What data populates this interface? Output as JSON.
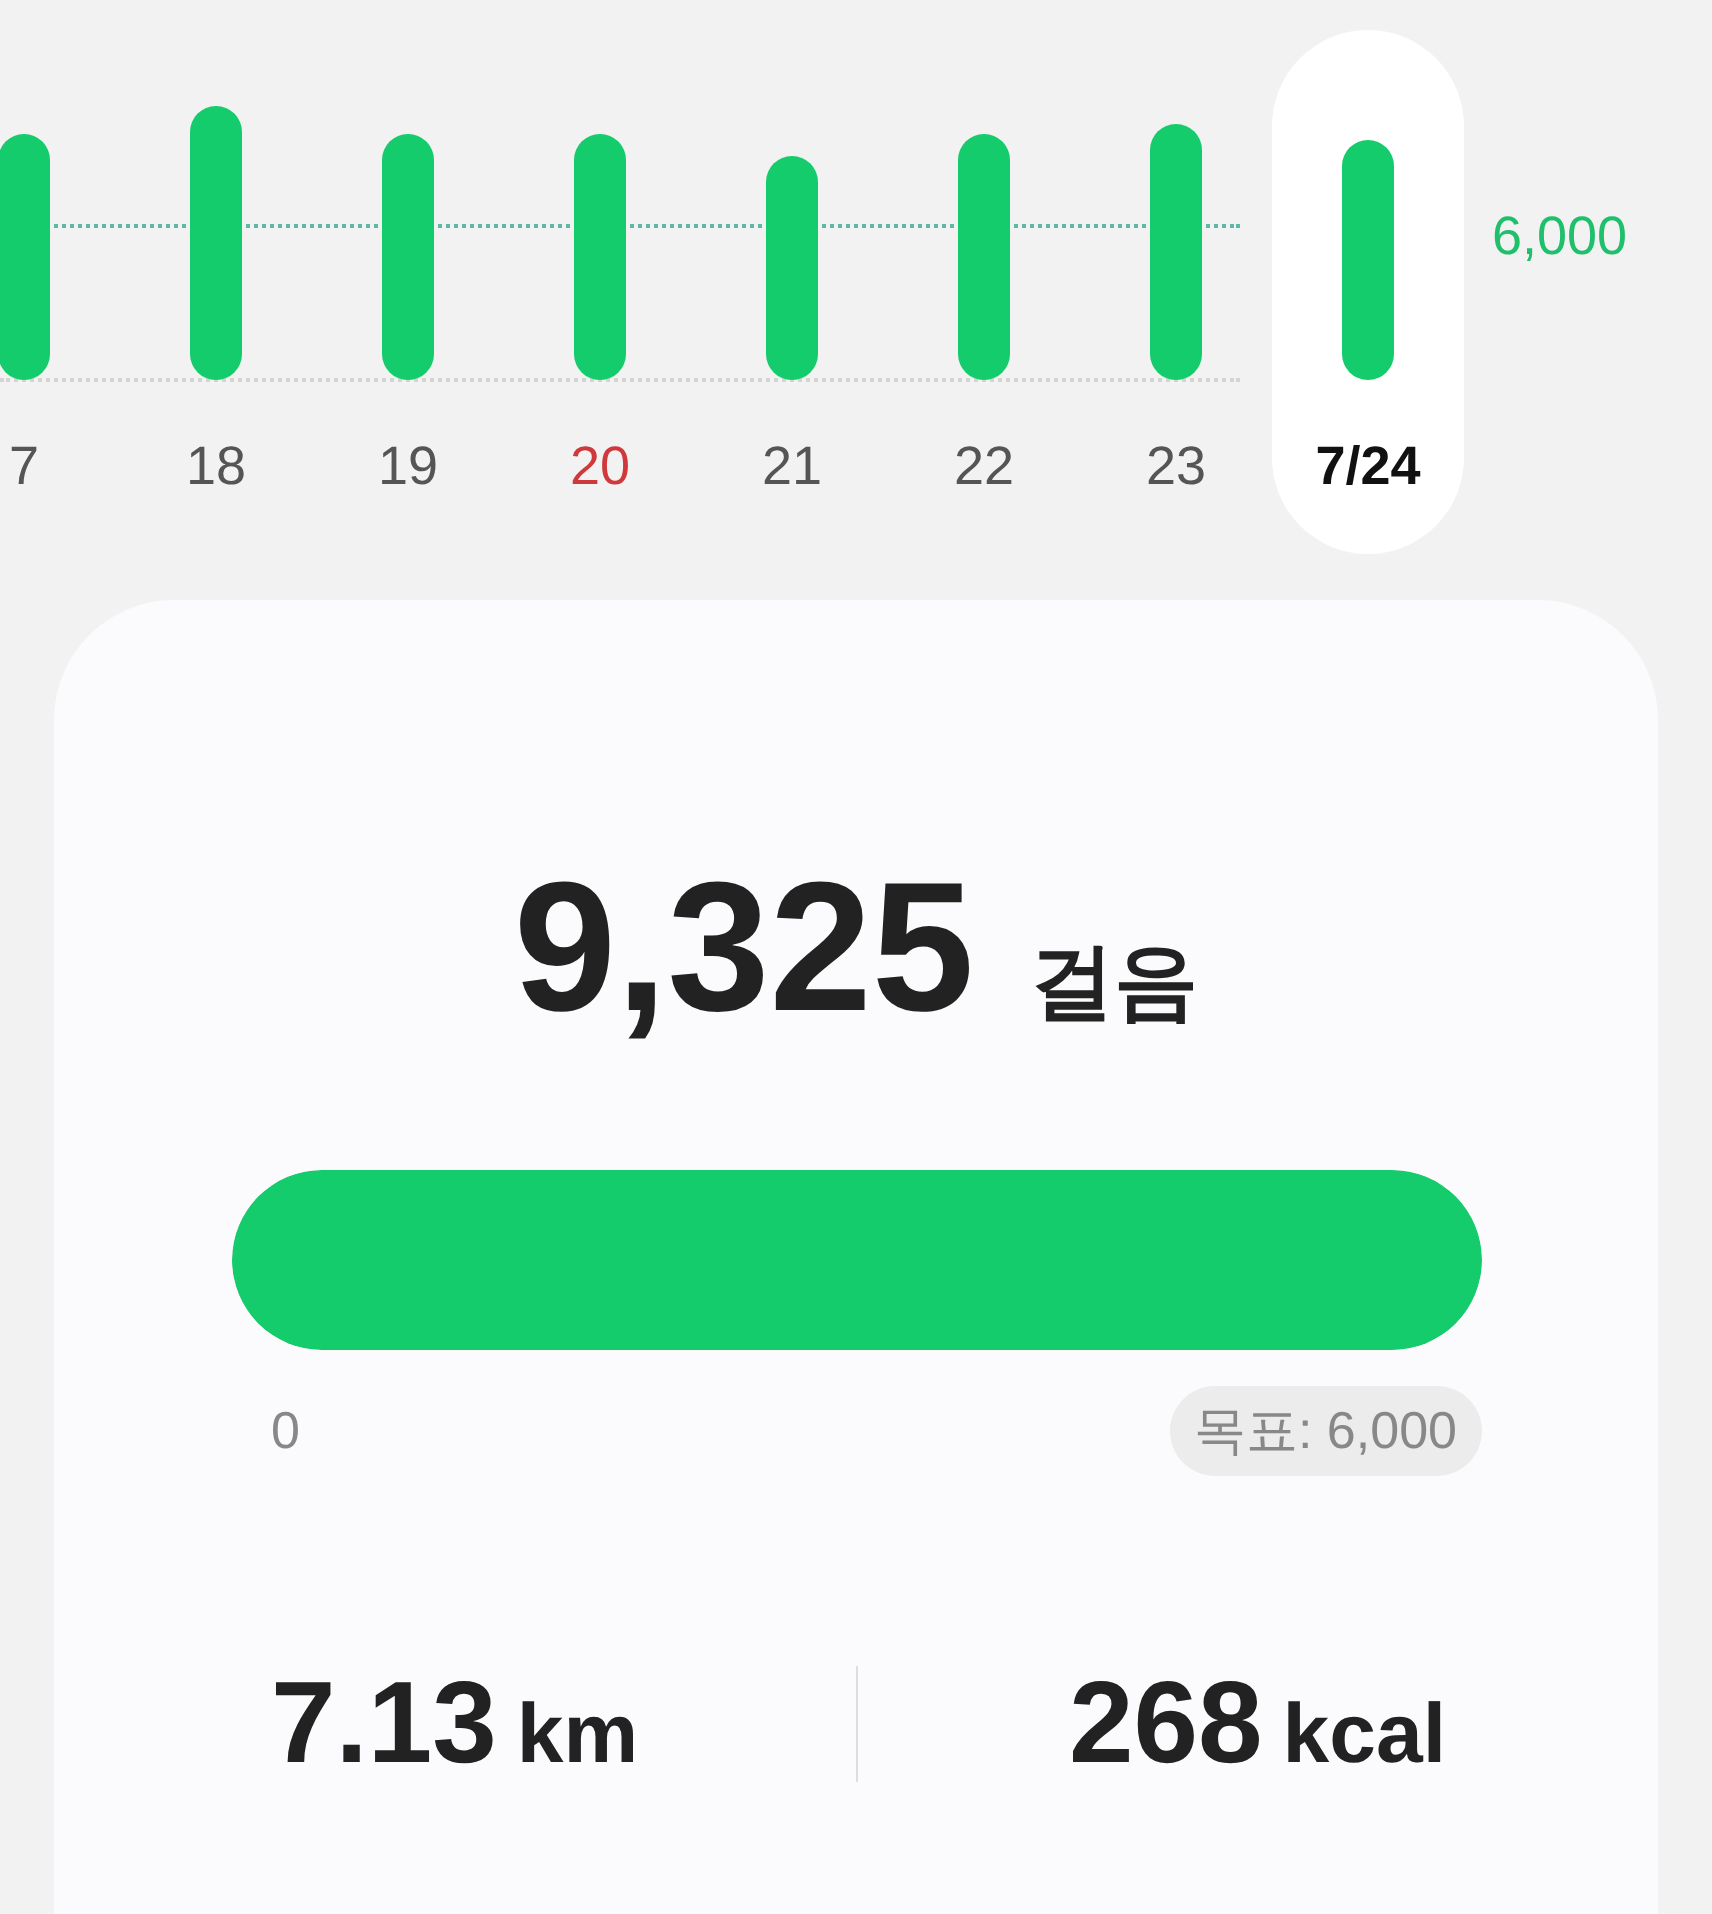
{
  "chart": {
    "goal_label": "6,000",
    "days": [
      {
        "label": "7",
        "selected": false,
        "color": "#555555"
      },
      {
        "label": "18",
        "selected": false,
        "color": "#555555"
      },
      {
        "label": "19",
        "selected": false,
        "color": "#555555"
      },
      {
        "label": "20",
        "selected": false,
        "color": "#d0393b"
      },
      {
        "label": "21",
        "selected": false,
        "color": "#555555"
      },
      {
        "label": "22",
        "selected": false,
        "color": "#555555"
      },
      {
        "label": "23",
        "selected": false,
        "color": "#555555"
      },
      {
        "label": "7/24",
        "selected": true,
        "color": "#111111"
      }
    ]
  },
  "summary": {
    "steps": "9,325",
    "steps_unit": "걸음",
    "progress": {
      "level": 1,
      "min_label": "0",
      "goal_label": "목표: 6,000"
    },
    "stats": [
      {
        "value": "7.13",
        "unit": "km"
      },
      {
        "value": "268",
        "unit": "kcal"
      }
    ]
  }
}
